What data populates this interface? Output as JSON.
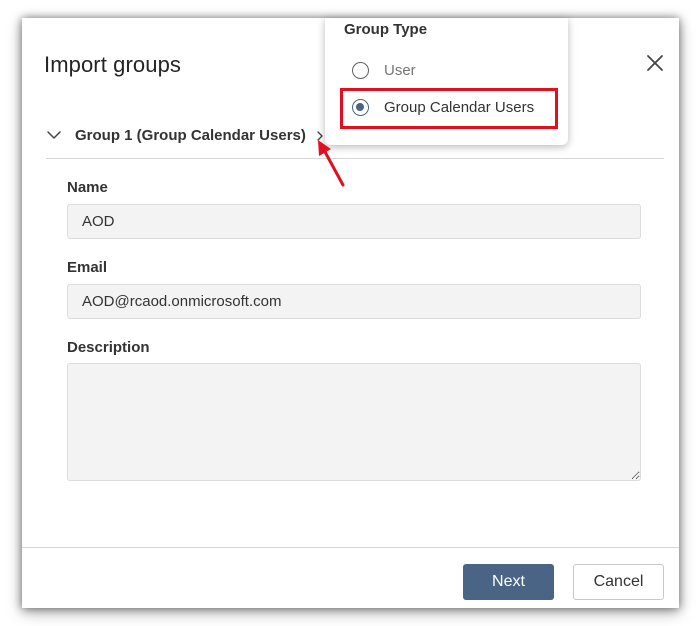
{
  "dialog": {
    "title": "Import groups",
    "close_icon": "close-icon"
  },
  "group_section": {
    "title": "Group 1 (Group Calendar Users)",
    "collapse_icon": "chevron-down-icon",
    "expand_icon": "chevron-right-icon"
  },
  "form": {
    "name": {
      "label": "Name",
      "value": "AOD"
    },
    "email": {
      "label": "Email",
      "value": "AOD@rcaod.onmicrosoft.com"
    },
    "description": {
      "label": "Description",
      "value": ""
    }
  },
  "footer": {
    "next_label": "Next",
    "cancel_label": "Cancel"
  },
  "group_type_popup": {
    "title": "Group Type",
    "options": [
      {
        "label": "User",
        "selected": false
      },
      {
        "label": "Group Calendar Users",
        "selected": true
      }
    ]
  },
  "annotations": {
    "highlight_color": "#e0101f",
    "arrow_color": "#e0101f"
  },
  "colors": {
    "primary_button": "#4a6486",
    "radio_selected": "#4a6486"
  }
}
